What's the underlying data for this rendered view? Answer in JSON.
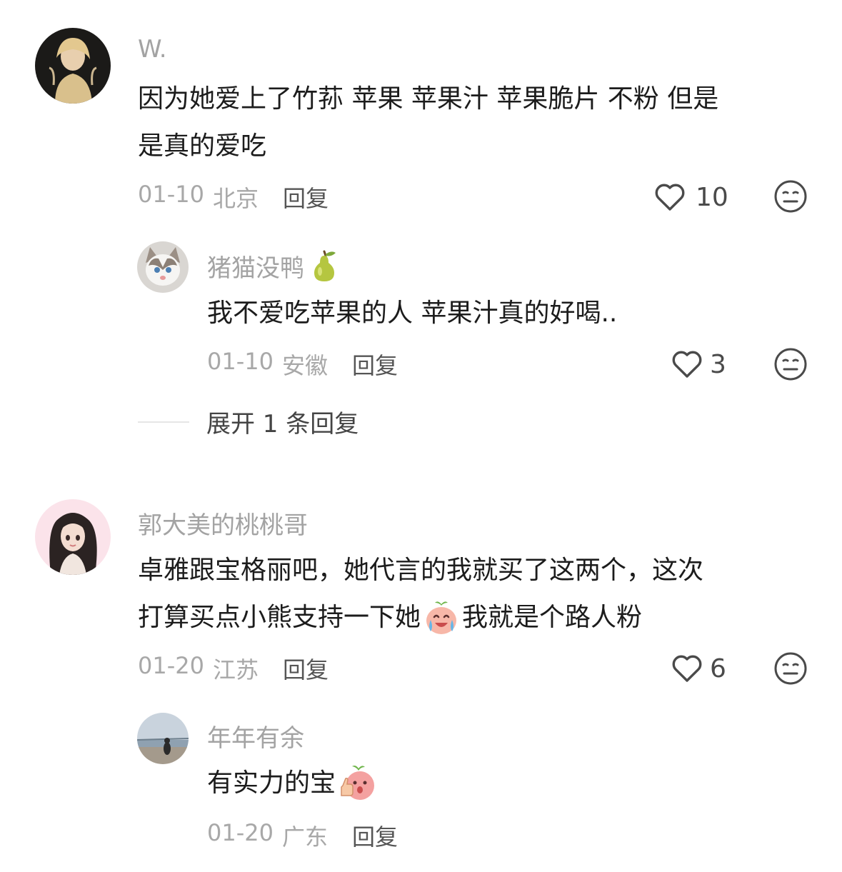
{
  "comments": [
    {
      "username": "W.",
      "text_lines": [
        "因为她爱上了竹荪 苹果 苹果汁 苹果脆片 不粉 但是",
        "是真的爱吃"
      ],
      "date": "01-10",
      "location": "北京",
      "reply_label": "回复",
      "likes": "10",
      "replies": [
        {
          "username": "猪猫没鸭",
          "badge_icon": "pear-emoji",
          "text": "我不爱吃苹果的人 苹果汁真的好喝..",
          "date": "01-10",
          "location": "安徽",
          "reply_label": "回复",
          "likes": "3"
        }
      ],
      "expand_label": "展开 1 条回复"
    },
    {
      "username": "郭大美的桃桃哥",
      "text_lines": [
        "卓雅跟宝格丽吧，她代言的我就买了这两个，这次",
        "打算买点小熊支持一下她",
        "我就是个路人粉"
      ],
      "inline_emoji": "crying-laughing-peach-emoji",
      "date": "01-20",
      "location": "江苏",
      "reply_label": "回复",
      "likes": "6",
      "replies": [
        {
          "username": "年年有余",
          "text": "有实力的宝",
          "inline_emoji": "thumbs-up-peach-emoji",
          "date": "01-20",
          "location": "广东",
          "reply_label": "回复"
        }
      ]
    }
  ],
  "colors": {
    "username": "#a3a3a3",
    "text": "#1c1c1c",
    "meta": "#a8a8a8",
    "reply": "#555555",
    "icon": "#4a4a4a"
  }
}
